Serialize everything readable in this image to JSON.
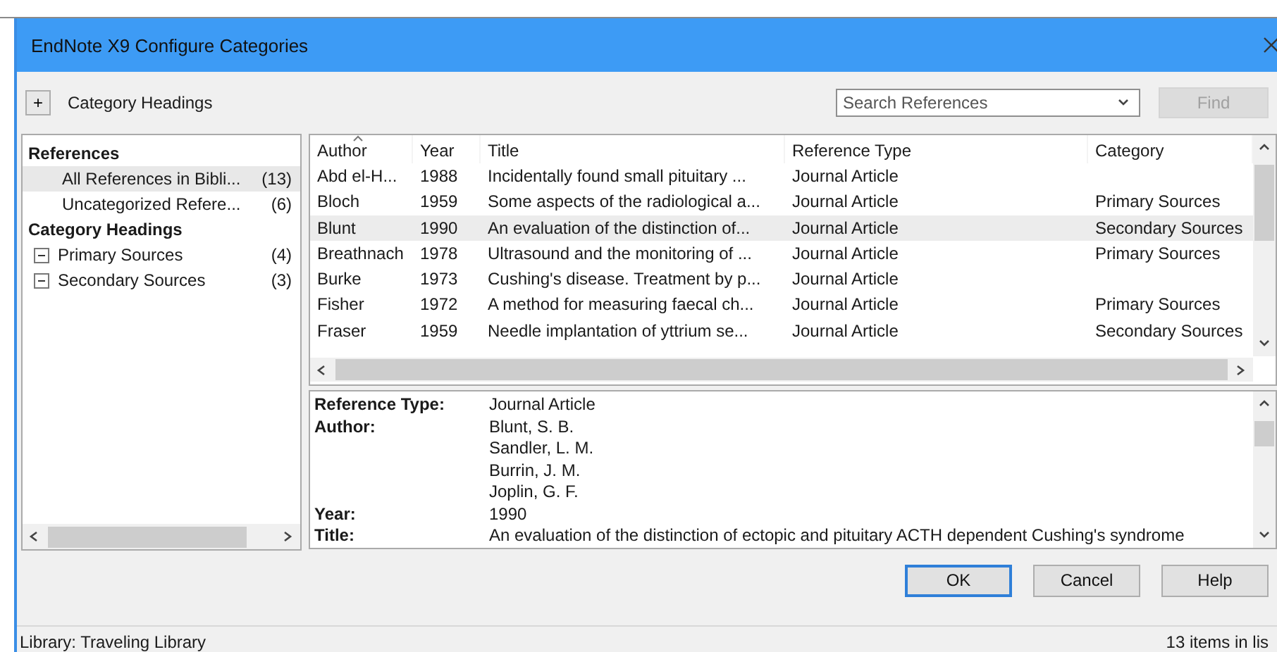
{
  "window": {
    "title": "EndNote X9 Configure Categories"
  },
  "toolbar": {
    "expand_label": "+",
    "heading": "Category Headings",
    "search": {
      "placeholder": "Search References"
    },
    "find_button": {
      "label": "Find",
      "disabled": true
    }
  },
  "sidebar": {
    "groups": [
      {
        "label": "References",
        "items": [
          {
            "label": "All References in Bibli...",
            "count": "(13)",
            "selected": true
          },
          {
            "label": "Uncategorized Refere...",
            "count": "(6)",
            "selected": false
          }
        ]
      },
      {
        "label": "Category Headings",
        "items": [
          {
            "label": "Primary Sources",
            "count": "(4)",
            "selected": false,
            "expanded": true
          },
          {
            "label": "Secondary Sources",
            "count": "(3)",
            "selected": false,
            "expanded": true
          }
        ]
      }
    ]
  },
  "table": {
    "columns": [
      "Author",
      "Year",
      "Title",
      "Reference Type",
      "Category"
    ],
    "rows": [
      {
        "cells": [
          "Abd el-H...",
          "1988",
          "Incidentally found small pituitary ...",
          "Journal Article",
          ""
        ],
        "selected": false
      },
      {
        "cells": [
          "Bloch",
          "1959",
          "Some aspects of the radiological a...",
          "Journal Article",
          "Primary Sources"
        ],
        "selected": false
      },
      {
        "cells": [
          "Blunt",
          "1990",
          "An evaluation of the distinction of...",
          "Journal Article",
          "Secondary Sources"
        ],
        "selected": true
      },
      {
        "cells": [
          "Breathnach",
          "1978",
          "Ultrasound and the monitoring of ...",
          "Journal Article",
          "Primary Sources"
        ],
        "selected": false
      },
      {
        "cells": [
          "Burke",
          "1973",
          "Cushing's disease. Treatment by p...",
          "Journal Article",
          ""
        ],
        "selected": false
      },
      {
        "cells": [
          "Fisher",
          "1972",
          "A method for measuring faecal ch...",
          "Journal Article",
          "Primary Sources"
        ],
        "selected": false
      },
      {
        "cells": [
          "Fraser",
          "1959",
          "Needle implantation of yttrium se...",
          "Journal Article",
          "Secondary Sources"
        ],
        "selected": false
      }
    ]
  },
  "preview": {
    "fields": [
      {
        "label": "Reference Type:",
        "values": [
          "Journal Article"
        ]
      },
      {
        "label": "Author:",
        "values": [
          "Blunt, S. B.",
          "Sandler, L. M.",
          "Burrin, J. M.",
          "Joplin, G. F."
        ]
      },
      {
        "label": "Year:",
        "values": [
          "1990"
        ]
      },
      {
        "label": "Title:",
        "values": [
          "An evaluation of the distinction of ectopic and pituitary ACTH dependent Cushing's syndrome"
        ]
      }
    ]
  },
  "buttons": [
    {
      "label": "OK",
      "default": true
    },
    {
      "label": "Cancel",
      "default": false
    },
    {
      "label": "Help",
      "default": false
    }
  ],
  "status_bar": {
    "library": "Library: Traveling Library",
    "count": "13 items in lis"
  }
}
